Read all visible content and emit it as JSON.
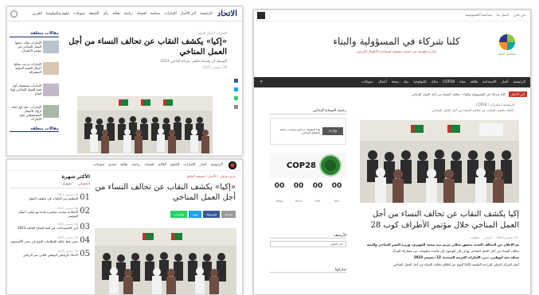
{
  "panel_a": {
    "logo": "الاتحاد",
    "nav_items": [
      "الرئيسية",
      "آخر الأخبار",
      "الإمارات",
      "سياسة",
      "اقتصاد",
      "رياضة",
      "ثقافة",
      "رأي",
      "الجمعة",
      "منوعات",
      "علوم وتكنولوجيا",
      "العربي"
    ],
    "side_title": "مقالات متعلقة",
    "side_items": [
      "الإمارات تؤكد دعمها العمل المناخي في مؤتمر الأطراف",
      "الإمارات ترحب بنتائج أعمال اللجنة الدولية المشتركة",
      "الإمارات تستضيف أول قمة للعمل المناخي لهذا العام",
      "الإمارات: عقد أول لقاء لرواد الأعمال المستقبليين حول الإمارات"
    ],
    "side_bottom": "مقالات متعلقة",
    "crumb": "الإمارات / أخبار الدولة",
    "title": "«إكيا» يكشف النقاب عن تحالف النساء من أجل العمل المناخي",
    "byline": "الوسيل أن يقدمنا ملتقى شركة الداعي 2023",
    "date": "16 ديسمبر 2023"
  },
  "panel_b": {
    "nav_items": [
      "الرئيسية",
      "أخبار",
      "الإمارات",
      "الخليج",
      "العالم",
      "اقتصاد",
      "رياضة",
      "ثقافة",
      "فيديو",
      "منوعات"
    ],
    "crumb": "عربي ودولي / الأخبار / صحيفة الخليج",
    "title": "«إكيا» يكشف النقاب عن تحالف النساء من أجل العمل المناخي",
    "share": [
      "شارك",
      "فيسبوك",
      "تويتر",
      "واتساب"
    ],
    "side_title": "الأكثر شهرة",
    "tabs": [
      "أسبوعي",
      "شهري"
    ],
    "items": [
      {
        "num": "01",
        "date": "16 ديسمبر 2023",
        "text": "التطعيم من النكبات في تنظيف الجهاز"
      },
      {
        "num": "02",
        "date": "16 ديسمبر 2023",
        "text": "الاتحادية تتحدث مباشرة بلادنا مع مكتب أعمال المؤتمر"
      },
      {
        "num": "03",
        "date": "16 ديسمبر 2023",
        "text": "أبرز الاستعدادات في قمة المناخ الحالية 2023"
      },
      {
        "num": "04",
        "date": "16 ديسمبر 2023",
        "text": "سعر نفط حالية القطاعات اليوم في سعر الألومنيوم"
      },
      {
        "num": "05",
        "date": "16 ديسمبر 2023",
        "text": "الاتحاد الرياضي الوطني الثاني عبر الرياض"
      }
    ]
  },
  "panel_c": {
    "top_links": [
      "من نحن",
      "اتصل بنا",
      "سياسة الخصوصية"
    ],
    "banner_title": "كلنا شركاء في المسؤولية والبناء",
    "banner_sub": "مبادرة تطوعية من جمعية مستقبل لمساعدة الأطفال المرضى",
    "logo_text": "مستقبل البيئة",
    "nav_items": [
      "الرئيسية",
      "أخبار",
      "الاستدامة",
      "طاقة",
      "مياه",
      "COP28",
      "مناخ",
      "تكنولوجيا",
      "بيئة",
      "صحة",
      "أعمال",
      "منوعات"
    ],
    "ticker_label": "آخر الأخبار",
    "ticker_text": "كلنا شركاء في المسؤولية والبناء - تحالف النساء من أجل العمل المناخي",
    "crumb": "الرئيسية / مبادرات / COP28",
    "crumb2": "«إكيا» يكشف النقاب عن تحالف النساء من أجل العمل المناخي",
    "title": "إكيا يكشف النقاب عن تحالف النساء من أجل العمل المناخي خلال مؤتمر الأطراف كوب 28",
    "meta": [
      "16 ديسمبر 2023",
      "المحرر",
      "تعليقات"
    ],
    "body": [
      {
        "bold": true,
        "text": "تم الإعلان عن التحالف الجديد بحضور معالي مريم بنت محمد المهيري، وزيرة التغير المناخي والبيئة"
      },
      {
        "bold": false,
        "text": "تحالف النساء من أجل العمل المناخي يهدف إلى الوصول إلى قاعدة معلومات عن مشاركة المرأة"
      },
      {
        "bold": true,
        "text": "شبكة بيئة أبوظبي، دبي، الإمارات العربية المتحدة، 13 ديسمبر 2023"
      },
      {
        "bold": false,
        "text": "أعلن المركز الدولي للزراعة الملحية (إكبا) اليوم عن إطلاق تحالف النساء من أجل العمل المناخي"
      }
    ],
    "side_title": "رخصة المشاع الإبداعي",
    "cc_badge": "cc by",
    "cc_text": "هذا المصنف مرخص بموجب رخصة المشاع الإبداعي",
    "cop_text": "COP28",
    "countdown": [
      {
        "value": "00",
        "unit": "Days"
      },
      {
        "value": "00",
        "unit": "Hour"
      },
      {
        "value": "00",
        "unit": "Min"
      },
      {
        "value": "00",
        "unit": "Sec"
      }
    ],
    "archive_title": "الأرشيف",
    "archive_select": "اختر الشهر",
    "sharikna": "شاركونا"
  },
  "colors": {
    "dark_blue": "#1c2f6e",
    "red": "#c0392b",
    "nav_dark": "#2b2b2b"
  }
}
